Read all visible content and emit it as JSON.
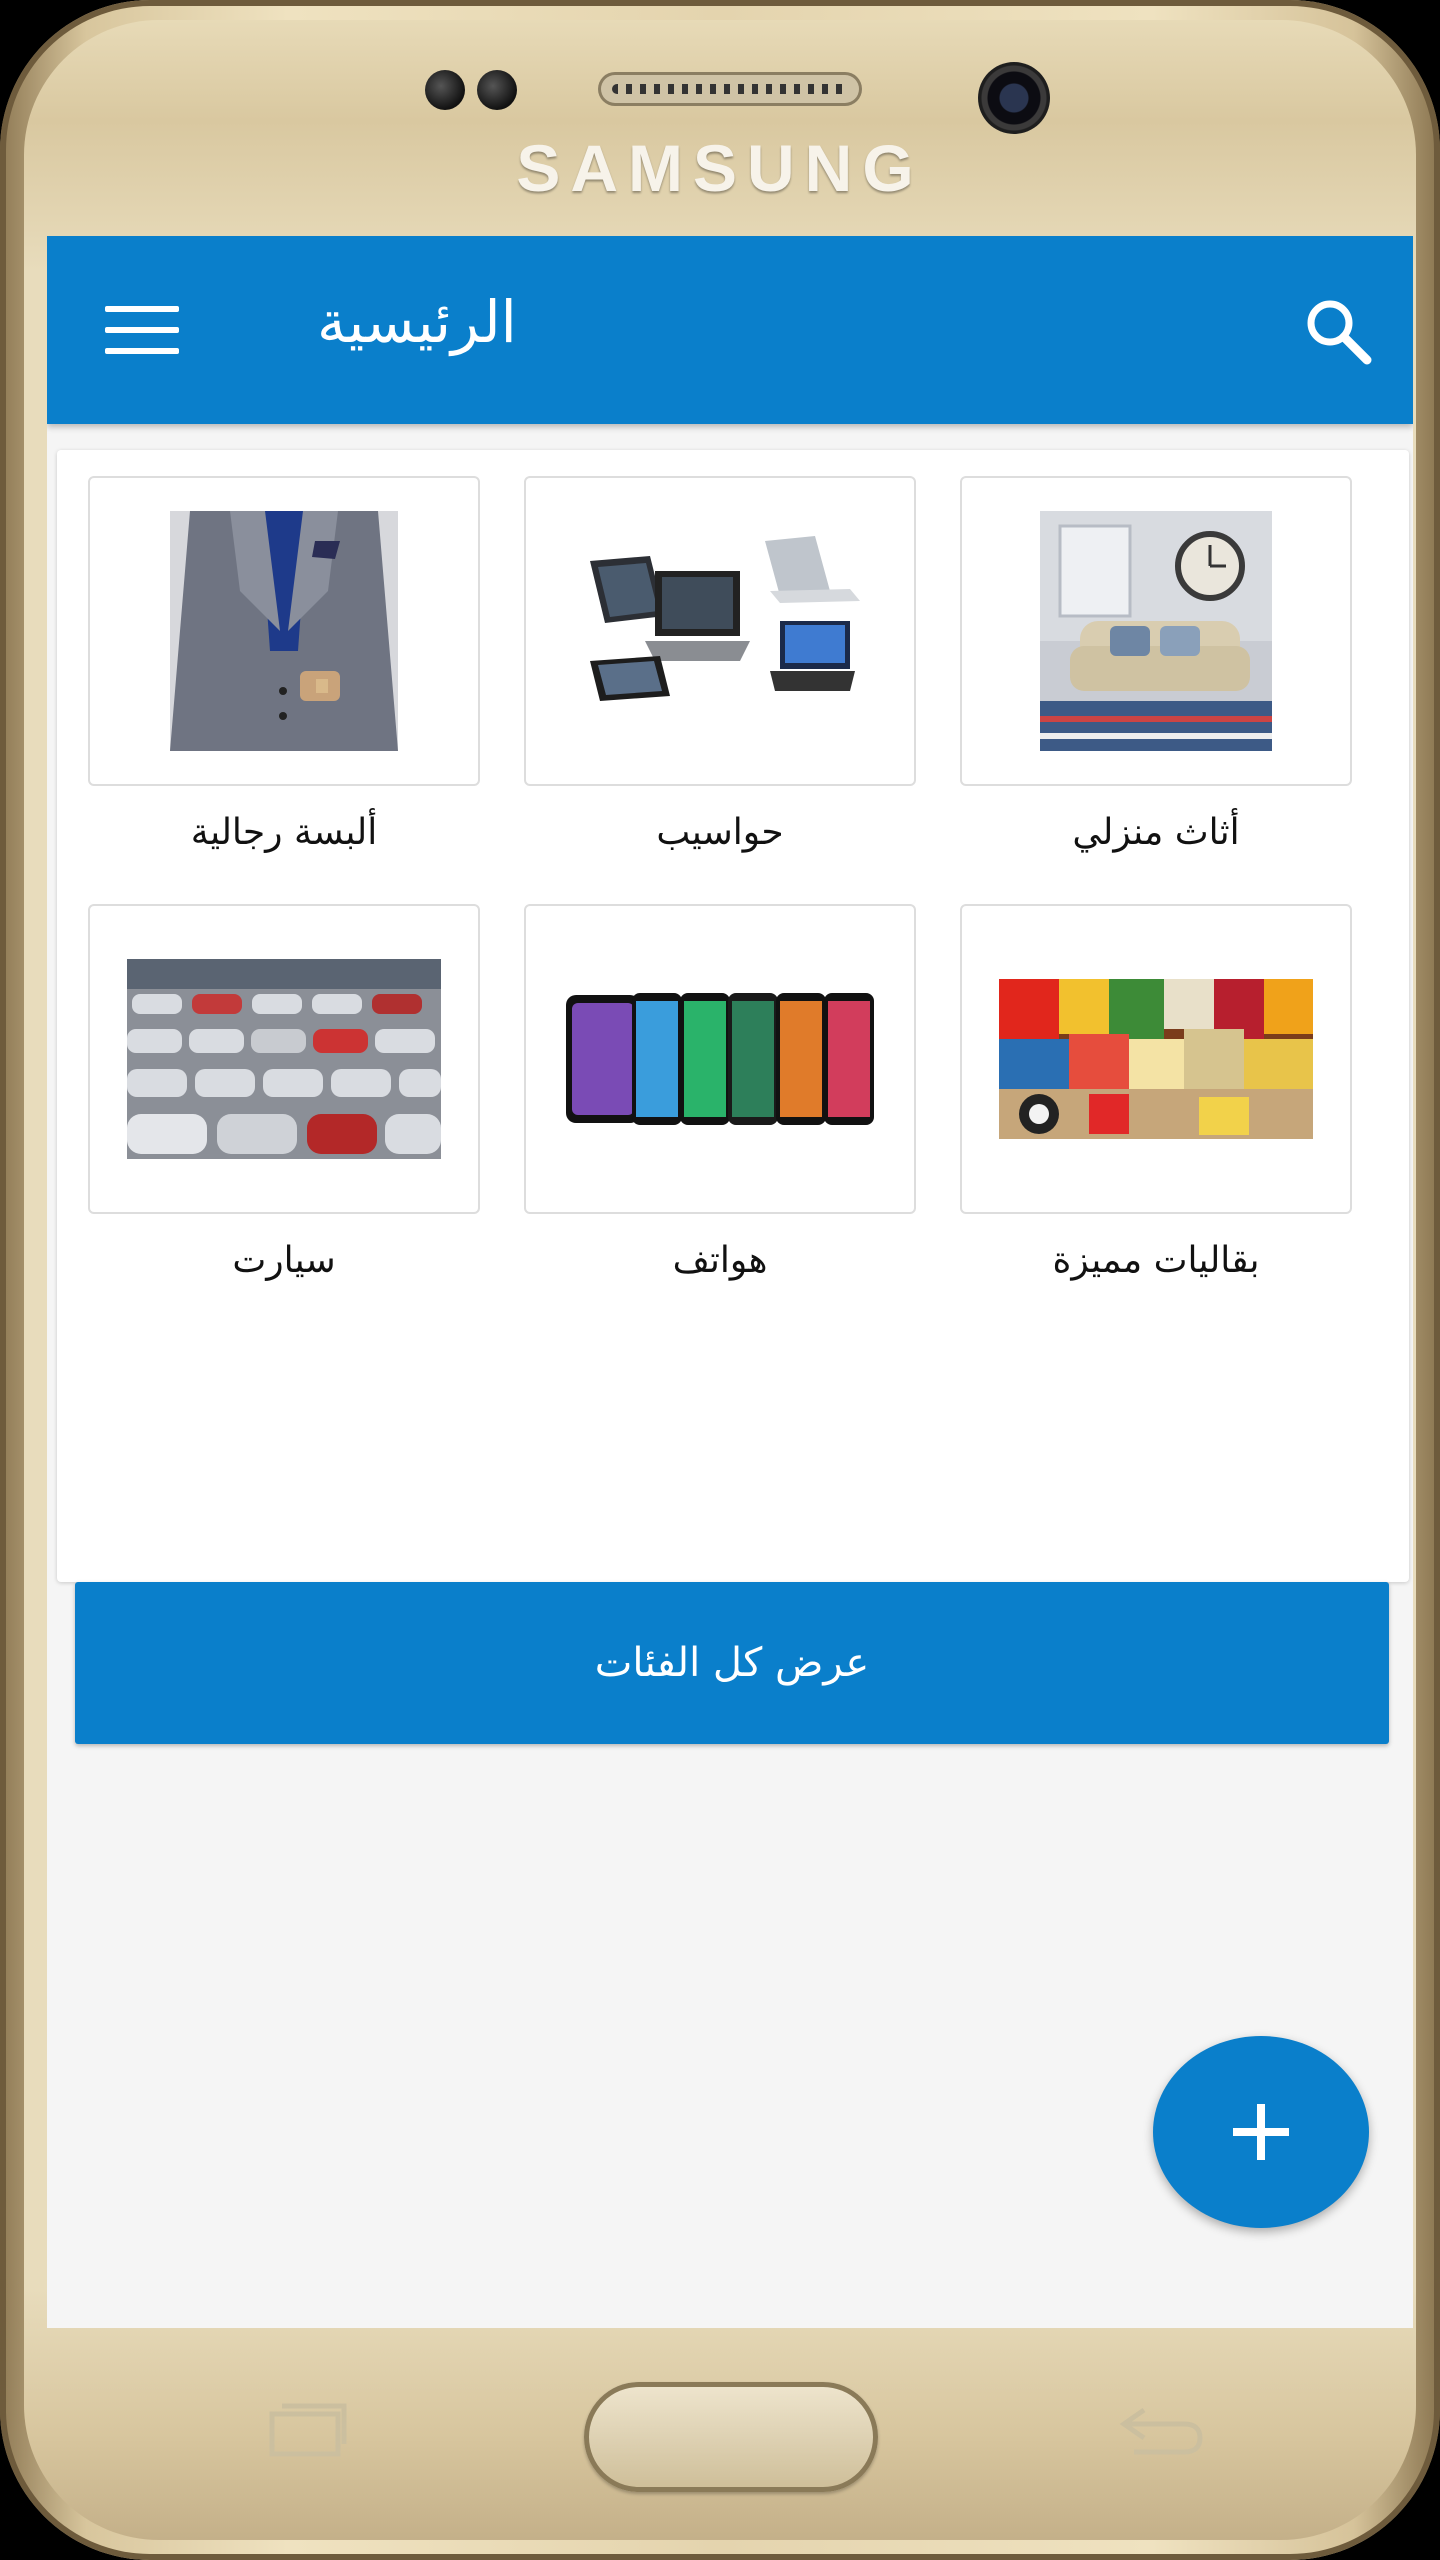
{
  "device": {
    "brand": "SAMSUNG"
  },
  "appbar": {
    "title": "الرئيسية",
    "menu_icon": "hamburger-menu-icon",
    "search_icon": "search-icon",
    "color": "#0a7fcb"
  },
  "categories": [
    {
      "label": "أثاث منزلي",
      "image": "furniture-photo"
    },
    {
      "label": "حواسيب",
      "image": "computers-photo"
    },
    {
      "label": "ألبسة رجالية",
      "image": "mens-clothing-photo"
    },
    {
      "label": "بقاليات مميزة",
      "image": "groceries-photo"
    },
    {
      "label": "هواتف",
      "image": "phones-photo"
    },
    {
      "label": "سيارت",
      "image": "cars-photo"
    }
  ],
  "view_all_button": {
    "label": "عرض كل الفئات"
  },
  "fab": {
    "icon": "plus-icon"
  },
  "nav_keys": {
    "recent": "recent-apps-icon",
    "home": "home-button",
    "back": "back-icon"
  }
}
